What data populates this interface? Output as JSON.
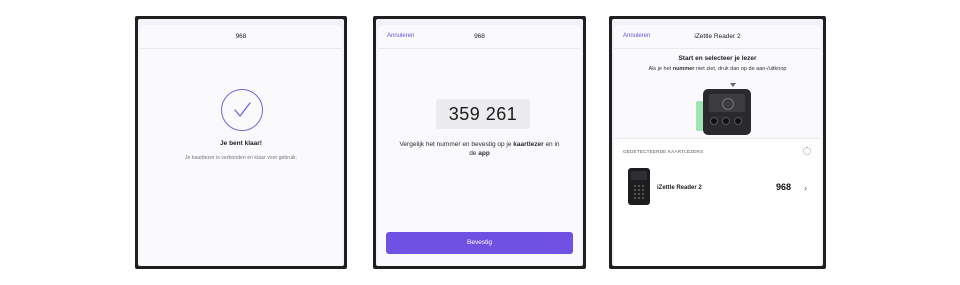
{
  "screen1": {
    "title": "968",
    "heading": "Je bent klaar!",
    "subtext": "Je kaartlezer is verbonden en klaar voor gebruik."
  },
  "screen2": {
    "cancel_label": "Annuleren",
    "title": "968",
    "code": "359 261",
    "compare_part1": "Vergelijk het nummer en bevestig op je ",
    "compare_bold1": "kaartlezer",
    "compare_part2": " en in de ",
    "compare_bold2": "app",
    "confirm_label": "Bevestig"
  },
  "screen3": {
    "cancel_label": "Annuleren",
    "title": "iZettle Reader 2",
    "heading": "Start en selecteer je lezer",
    "sub_part1": "Als je het ",
    "sub_bold": "nummer",
    "sub_part2": " niet ziet, druk dan op de aan-/uitknop",
    "section_label": "GEDETECTEERDE KAARTLEZERS",
    "readers": [
      {
        "name": "iZettle Reader 2",
        "number": "968"
      }
    ]
  },
  "icons": {
    "check": "check-icon",
    "chevron": "chevron-right-icon",
    "spinner": "loading-spinner-icon",
    "arrow": "arrow-down-icon"
  },
  "colors": {
    "accent": "#6f52e3",
    "indicator": "#9fe5b3"
  }
}
